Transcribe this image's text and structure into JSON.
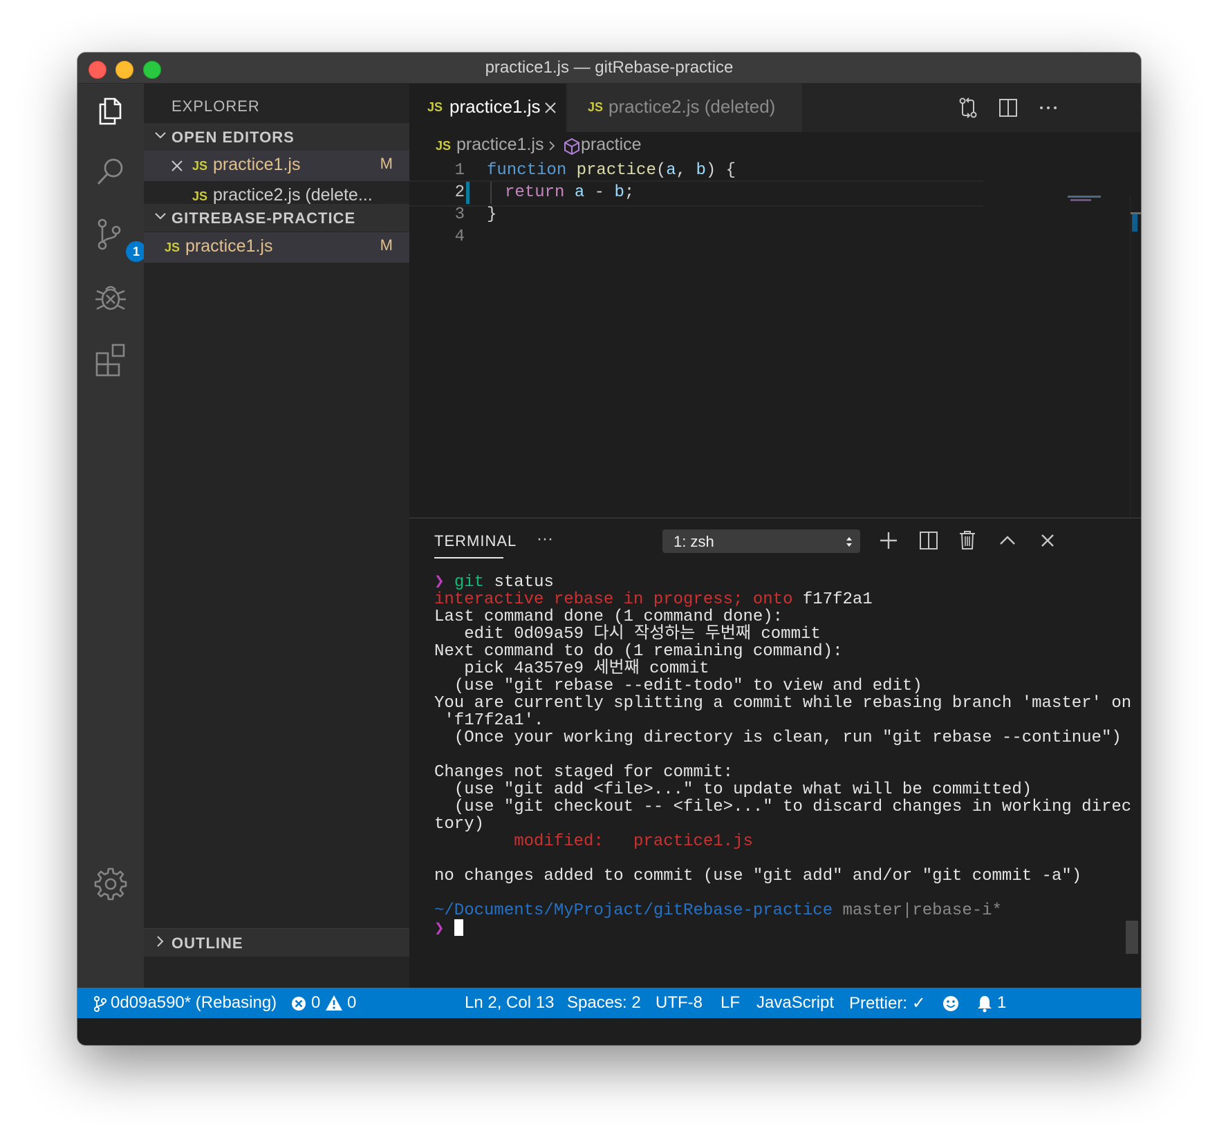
{
  "window": {
    "title": "practice1.js — gitRebase-practice"
  },
  "activity_bar": {
    "scm_badge": "1"
  },
  "sidebar": {
    "title": "EXPLORER",
    "open_editors": {
      "header": "OPEN EDITORS",
      "items": [
        {
          "icon": "JS",
          "name": "practice1.js",
          "flag": "M"
        },
        {
          "icon": "JS",
          "name": "practice2.js (delete...",
          "flag": ""
        }
      ]
    },
    "project": {
      "header": "GITREBASE-PRACTICE",
      "items": [
        {
          "icon": "JS",
          "name": "practice1.js",
          "flag": "M"
        }
      ]
    },
    "outline": {
      "header": "OUTLINE"
    }
  },
  "editor": {
    "tabs": [
      {
        "icon": "JS",
        "label": "practice1.js"
      },
      {
        "icon": "JS",
        "label": "practice2.js (deleted)"
      }
    ],
    "breadcrumb": {
      "icon": "JS",
      "file": "practice1.js",
      "symbol": "practice"
    },
    "line_numbers": [
      "1",
      "2",
      "3",
      "4"
    ],
    "code": {
      "l1": {
        "kw": "function",
        "fn": "practice",
        "open": "(",
        "p1": "a",
        "comma": ", ",
        "p2": "b",
        "close": ") {"
      },
      "l2": {
        "kw": "return",
        "a": "a",
        "op": " - ",
        "b": "b",
        "semi": ";"
      },
      "l3": "}"
    }
  },
  "terminal": {
    "tab": "TERMINAL",
    "more": "···",
    "shell_select": "1: zsh",
    "prompt_symbol": "❯",
    "command_git": "git",
    "command_rest": " status",
    "rebase_line_red": "interactive rebase in progress; onto",
    "rebase_line_hash": " f17f2a1",
    "lines_a": "Last command done (1 command done):\n   edit 0d09a59 다시 작성하는 두번째 commit\nNext command to do (1 remaining command):\n   pick 4a357e9 세번째 commit\n  (use \"git rebase --edit-todo\" to view and edit)\nYou are currently splitting a commit while rebasing branch 'master' on\n 'f17f2a1'.\n  (Once your working directory is clean, run \"git rebase --continue\")\n\nChanges not staged for commit:\n  (use \"git add <file>...\" to update what will be committed)\n  (use \"git checkout -- <file>...\" to discard changes in working direc\ntory)\n",
    "modified_label": "        modified:   practice1.js",
    "lines_b": "\nno changes added to commit (use \"git add\" and/or \"git commit -a\")\n",
    "cwd": "~/Documents/MyProjact/gitRebase-practice",
    "git_info": " master|rebase-i*"
  },
  "status_bar": {
    "branch": "0d09a590* (Rebasing)",
    "errors": "0",
    "warnings": "0",
    "cursor": "Ln 2, Col 13",
    "spaces": "Spaces: 2",
    "encoding": "UTF-8",
    "eol": "LF",
    "language": "JavaScript",
    "formatter": "Prettier: ✓",
    "notifications": "1"
  },
  "colors": {
    "accent": "#007acc",
    "editor_bg": "#1e1e1e",
    "sidebar_bg": "#252526",
    "activity_bg": "#333333",
    "js_icon": "#cbcb41",
    "modified": "#e2c08d"
  },
  "icons": [
    "files-icon",
    "search-icon",
    "source-control-icon",
    "debug-icon",
    "extensions-icon",
    "settings-gear-icon",
    "close-icon",
    "chevron-down-icon",
    "chevron-right-icon",
    "symbol-method-icon",
    "compare-changes-icon",
    "split-editor-icon",
    "more-actions-icon",
    "plus-icon",
    "trash-icon",
    "chevron-up-icon",
    "branch-icon",
    "error-icon",
    "warning-icon",
    "smiley-icon",
    "bell-icon"
  ]
}
